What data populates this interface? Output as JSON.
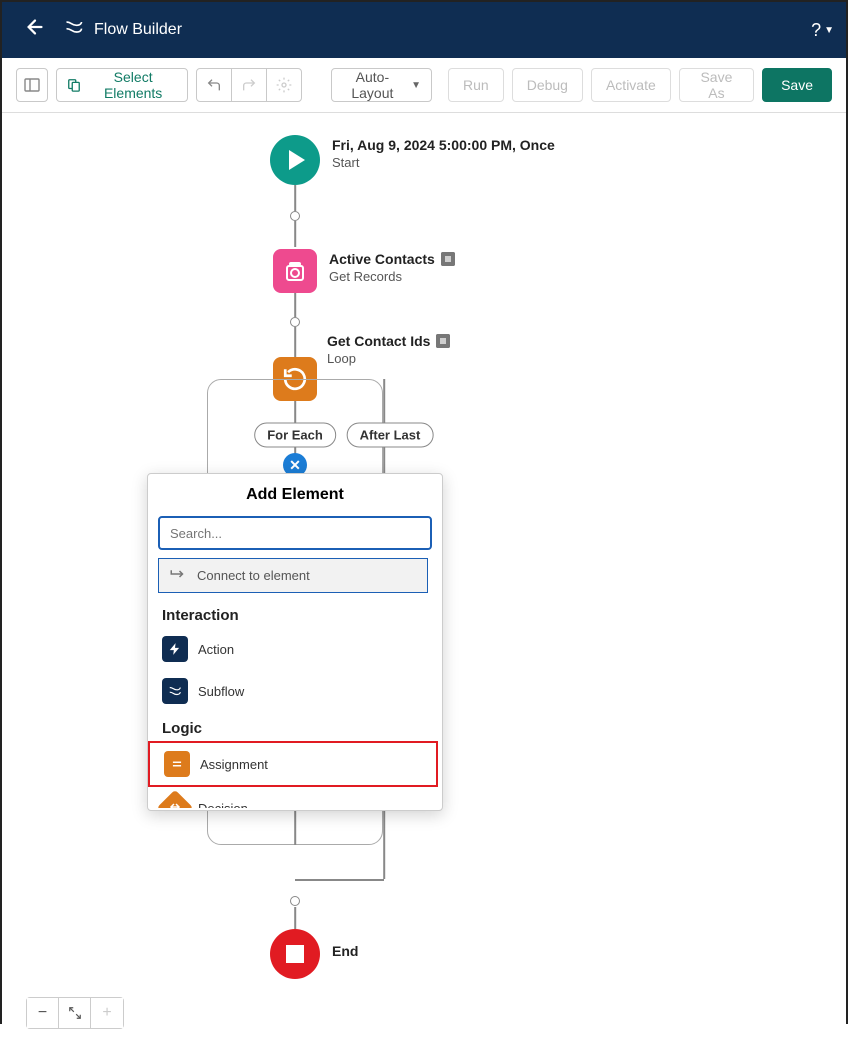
{
  "header": {
    "title": "Flow Builder",
    "help": "?"
  },
  "toolbar": {
    "select_elements": "Select Elements",
    "auto_layout": "Auto-Layout",
    "run": "Run",
    "debug": "Debug",
    "activate": "Activate",
    "save_as": "Save As",
    "save": "Save"
  },
  "nodes": {
    "start": {
      "title": "Fri, Aug 9, 2024 5:00:00 PM, Once",
      "sub": "Start"
    },
    "get_records": {
      "title": "Active Contacts",
      "sub": "Get Records"
    },
    "loop": {
      "title": "Get Contact Ids",
      "sub": "Loop"
    },
    "end": {
      "title": "End"
    }
  },
  "branches": {
    "for_each": "For Each",
    "after_last": "After Last"
  },
  "popover": {
    "title": "Add Element",
    "search_placeholder": "Search...",
    "connect": "Connect to element",
    "cat_interaction": "Interaction",
    "cat_logic": "Logic",
    "items": {
      "action": "Action",
      "subflow": "Subflow",
      "assignment": "Assignment",
      "decision": "Decision"
    }
  },
  "zoom": {
    "minus": "−",
    "fit": "⤢",
    "plus": "+"
  }
}
